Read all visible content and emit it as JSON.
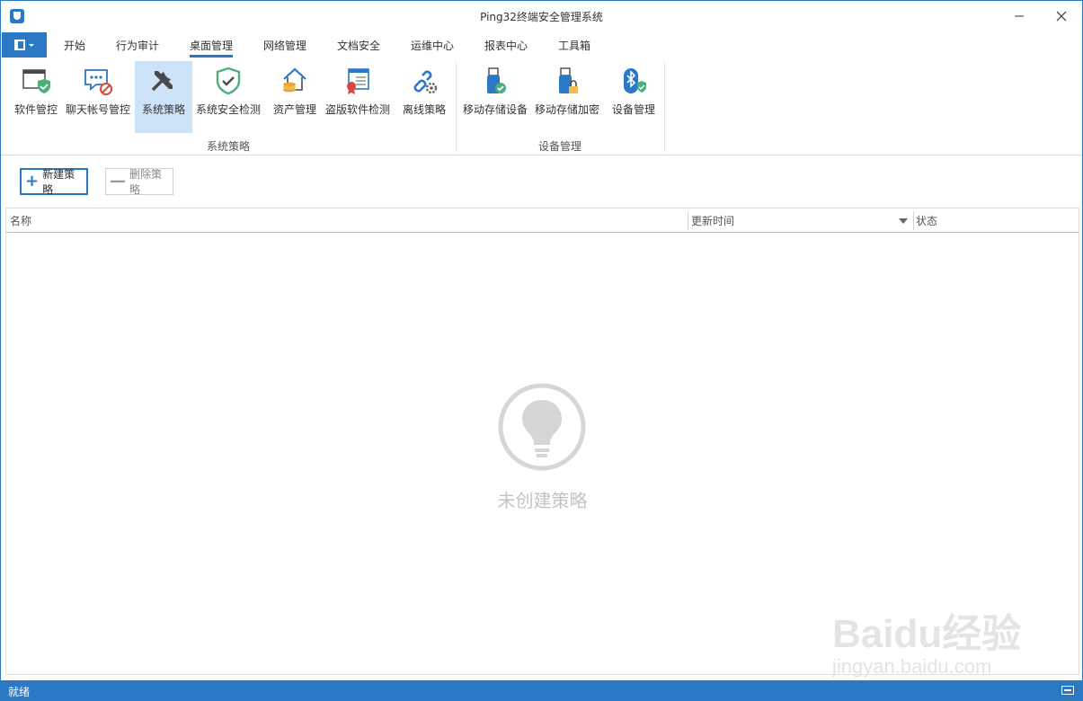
{
  "window": {
    "title": "Ping32终端安全管理系统"
  },
  "menu": {
    "tabs": [
      {
        "label": "开始"
      },
      {
        "label": "行为审计"
      },
      {
        "label": "桌面管理"
      },
      {
        "label": "网络管理"
      },
      {
        "label": "文档安全"
      },
      {
        "label": "运维中心"
      },
      {
        "label": "报表中心"
      },
      {
        "label": "工具箱"
      }
    ],
    "active_tab": "桌面管理"
  },
  "ribbon": {
    "groups": [
      {
        "label": "系统策略",
        "items": [
          {
            "label": "软件管控",
            "icon": "software-control-icon"
          },
          {
            "label": "聊天帐号管控",
            "icon": "chat-account-control-icon"
          },
          {
            "label": "系统策略",
            "icon": "system-policy-tools-icon",
            "selected": true
          },
          {
            "label": "系统安全检测",
            "icon": "security-check-shield-icon"
          },
          {
            "label": "资产管理",
            "icon": "asset-management-icon"
          },
          {
            "label": "盗版软件检测",
            "icon": "pirated-software-detection-icon"
          },
          {
            "label": "离线策略",
            "icon": "offline-policy-icon"
          }
        ]
      },
      {
        "label": "设备管理",
        "items": [
          {
            "label": "移动存储设备",
            "icon": "usb-storage-icon"
          },
          {
            "label": "移动存储加密",
            "icon": "usb-encryption-icon"
          },
          {
            "label": "设备管理",
            "icon": "bluetooth-device-icon"
          }
        ]
      }
    ]
  },
  "toolbar": {
    "new_label": "新建策略",
    "delete_label": "删除策略"
  },
  "table": {
    "columns": [
      "名称",
      "更新时间",
      "状态"
    ],
    "sorted_column": "更新时间",
    "rows": [],
    "empty_text": "未创建策略"
  },
  "watermark": {
    "main": "Baidu经验",
    "sub": "jingyan.baidu.com"
  },
  "status": {
    "text": "就绪"
  },
  "colors": {
    "accent": "#2b78c4",
    "ribbon_selected": "#cde3f7"
  }
}
